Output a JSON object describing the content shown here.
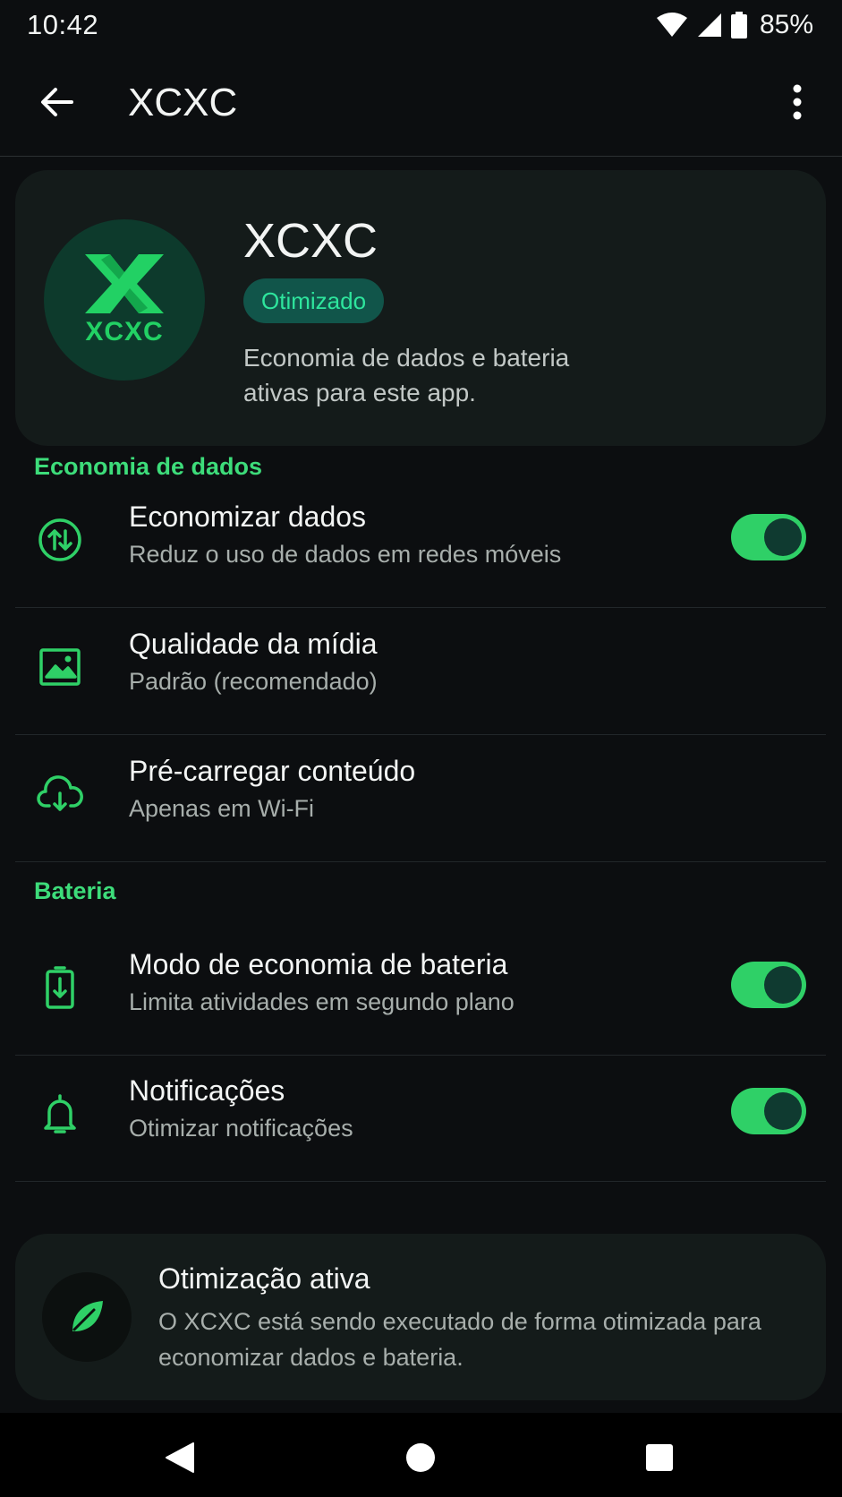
{
  "status_bar": {
    "time": "10:42",
    "battery": "85%"
  },
  "app_bar": {
    "title": "XCXC"
  },
  "app_card": {
    "logo_text": "XCXC",
    "name": "XCXC",
    "badge": "Otimizado",
    "description": "Economia de dados e bateria ativas para este app."
  },
  "sections": {
    "data": {
      "header": "Economia de dados",
      "items": [
        {
          "title": "Economizar dados",
          "subtitle": "Reduz o uso de dados em redes móveis",
          "icon": "data-transfer-icon",
          "toggle": true
        },
        {
          "title": "Qualidade da mídia",
          "subtitle": "Padrão (recomendado)",
          "icon": "image-icon"
        },
        {
          "title": "Pré-carregar conteúdo",
          "subtitle": "Apenas em Wi-Fi",
          "icon": "cloud-download-icon"
        }
      ]
    },
    "battery": {
      "header": "Bateria",
      "items": [
        {
          "title": "Modo de economia de bateria",
          "subtitle": "Limita atividades em segundo plano",
          "icon": "battery-saver-icon",
          "toggle": true
        },
        {
          "title": "Notificações",
          "subtitle": "Otimizar notificações",
          "icon": "bell-icon",
          "toggle": true
        }
      ]
    }
  },
  "info_card": {
    "title": "Otimização ativa",
    "text": "O XCXC está sendo executado de forma otimizada para economizar dados e bateria."
  },
  "colors": {
    "accent": "#2fd067",
    "background": "#0c0e10",
    "card": "#141b1a"
  }
}
